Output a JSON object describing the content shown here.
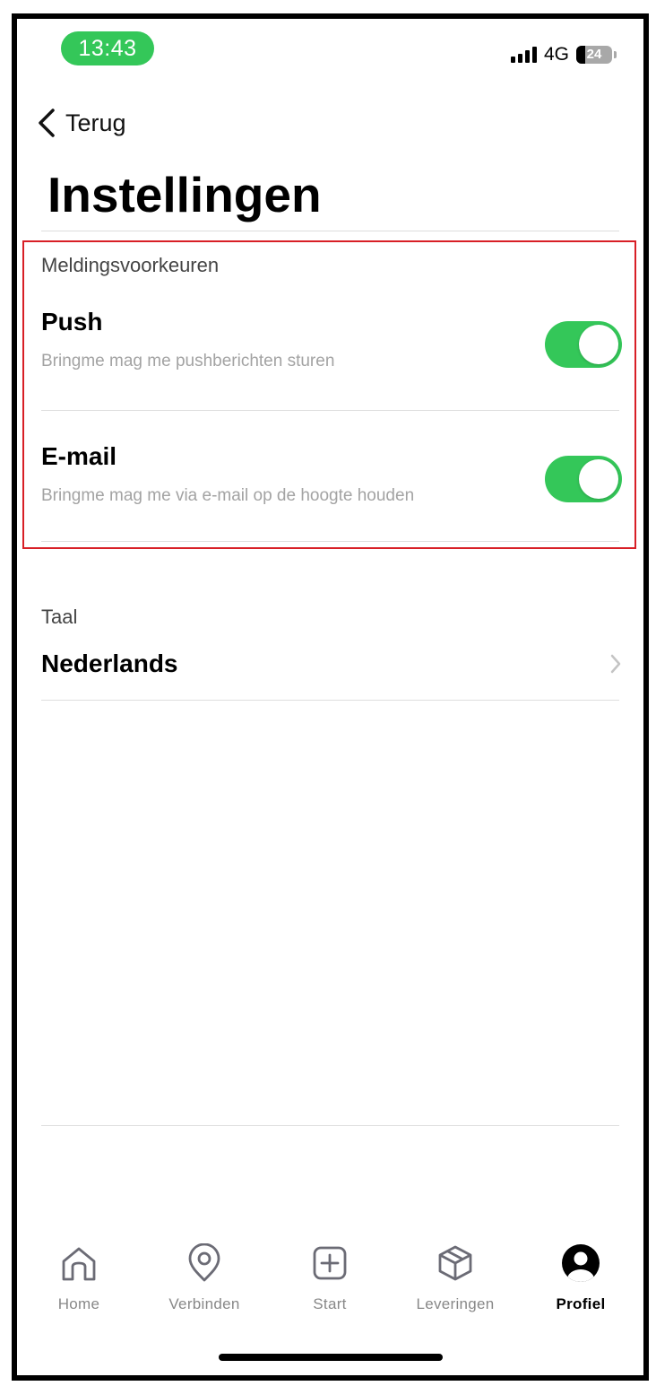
{
  "status_bar": {
    "time": "13:43",
    "network": "4G",
    "battery_level": "24",
    "battery_fraction": 0.24,
    "time_pill_color": "#34c759"
  },
  "nav": {
    "back_label": "Terug",
    "back_icon": "chevron-left-icon"
  },
  "page": {
    "title": "Instellingen"
  },
  "notifications": {
    "section_label": "Meldingsvoorkeuren",
    "push": {
      "title": "Push",
      "subtitle": "Bringme mag me pushberichten sturen",
      "enabled": true
    },
    "email": {
      "title": "E-mail",
      "subtitle": "Bringme mag me via e-mail op de hoogte houden",
      "enabled": true
    },
    "toggle_on_color": "#34c759",
    "highlight_color": "#d81f26"
  },
  "language": {
    "section_label": "Taal",
    "value": "Nederlands",
    "icon": "chevron-right-icon"
  },
  "tabbar": {
    "items": [
      {
        "label": "Home",
        "icon": "home-icon",
        "active": false
      },
      {
        "label": "Verbinden",
        "icon": "location-pin-icon",
        "active": false
      },
      {
        "label": "Start",
        "icon": "plus-square-icon",
        "active": false
      },
      {
        "label": "Leveringen",
        "icon": "package-box-icon",
        "active": false
      },
      {
        "label": "Profiel",
        "icon": "profile-avatar-icon",
        "active": true
      }
    ]
  }
}
